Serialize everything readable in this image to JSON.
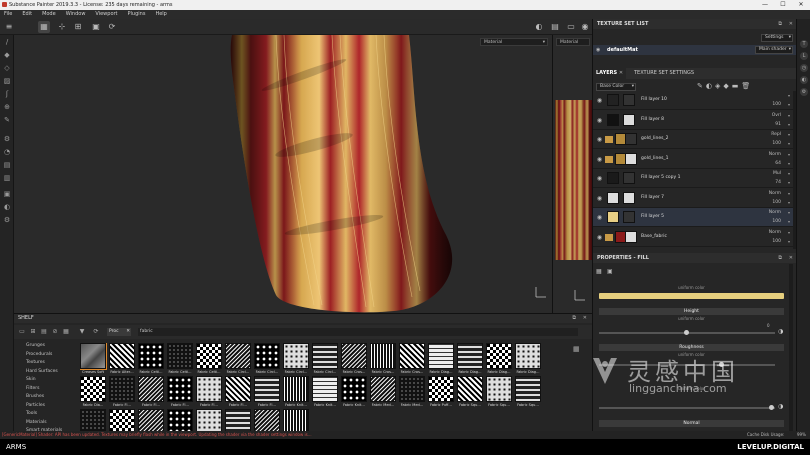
{
  "title_bar": {
    "text": "Substance Painter 2019.3.3 - License: 235 days remaining - arms"
  },
  "menu": [
    "File",
    "Edit",
    "Mode",
    "Window",
    "Viewport",
    "Plugins",
    "Help"
  ],
  "viewport": {
    "material_left": "Material",
    "material_right": "Material"
  },
  "texture_set_list": {
    "title": "TEXTURE SET LIST",
    "settings_label": "Settings",
    "texture_set": "defaultMat",
    "shader": "Main shader"
  },
  "layers_panel": {
    "tab_layers": "LAYERS",
    "tab_tss": "TEXTURE SET SETTINGS",
    "channel": "Base Color",
    "layers": [
      {
        "name": "Fill layer 10",
        "blend": "",
        "opacity": "100",
        "folder": false,
        "thumb": "#222222"
      },
      {
        "name": "Fill layer 8",
        "blend": "Ovrl",
        "opacity": "91",
        "folder": false,
        "thumb": "#111111"
      },
      {
        "name": "gold_lines_2",
        "blend": "Repl",
        "opacity": "100",
        "folder": true,
        "thumb": "#b38a3a"
      },
      {
        "name": "gold_lines_1",
        "blend": "Norm",
        "opacity": "64",
        "folder": true,
        "thumb": "#b38a3a"
      },
      {
        "name": "Fill layer 5 copy 1",
        "blend": "Mul",
        "opacity": "74",
        "folder": false,
        "thumb": "#1a1a1a"
      },
      {
        "name": "Fill layer 7",
        "blend": "Norm",
        "opacity": "100",
        "folder": false,
        "thumb": "#dddddd"
      },
      {
        "name": "Fill layer 5",
        "blend": "Norm",
        "opacity": "100",
        "folder": false,
        "thumb": "#e8cf85"
      },
      {
        "name": "Base_fabric",
        "blend": "Norm",
        "opacity": "100",
        "folder": true,
        "thumb": "#8b1a1a"
      }
    ]
  },
  "properties": {
    "title": "PROPERTIES - FILL",
    "base_color_sub": "uniform color",
    "base_color_hex": "#e6cf7e",
    "height_label": "Height",
    "height_sub": "uniform color",
    "height_value": "0",
    "roughness_label": "Roughness",
    "roughness_sub": "uniform color",
    "metallic_sub": "uniform color",
    "normal_label": "Normal"
  },
  "shelf": {
    "title": "SHELF",
    "filter_chip": "Proc",
    "search_text": "fabric",
    "categories": [
      "Grunges",
      "Procedurals",
      "Textures",
      "Hard Surfaces",
      "Skin",
      "Filters",
      "Brushes",
      "Particles",
      "Tools",
      "Materials",
      "Smart materials"
    ],
    "row1_labels": [
      "Creases Soft",
      "Fabric Alter…",
      "Fabric Celti…",
      "Fabric Celti…",
      "Fabric Celti…",
      "Fabric Circl…",
      "Fabric Circl…",
      "Fabric Circl…",
      "Fabric Circl…",
      "Fabric Cros…",
      "Fabric Cros…",
      "Fabric Cros…",
      "Fabric Diag…",
      "Fabric Diag…",
      "Fabric Diag…",
      "Fabric Diag…"
    ],
    "row2_labels": [
      "Fabric Dia…",
      "Fabric Fl…",
      "Fabric Fl…",
      "Fabric Fl…",
      "Fabric Fl…",
      "Fabric Fl…",
      "Fabric Fl…",
      "Fabric Knit…",
      "Fabric Knit…",
      "Fabric Knit…",
      "Fabric Med…",
      "Fabric Med…",
      "Fabric Puff…",
      "Fabric Squ…",
      "Fabric Squ…",
      "Fabric Squ…"
    ]
  },
  "status": {
    "message": "[GenericMaterial] Shader: API has been updated. Textures may briefly flash while in the viewport. Updating the shader via the shader settings window is…",
    "cache": "Cache Disk Usage:",
    "cache_value": "99%"
  },
  "bottom": {
    "left": "ARMS",
    "right": "LEVELUP.DIGITAL"
  },
  "watermark": {
    "cn": "灵感中国",
    "url": "lingganchina.com"
  }
}
